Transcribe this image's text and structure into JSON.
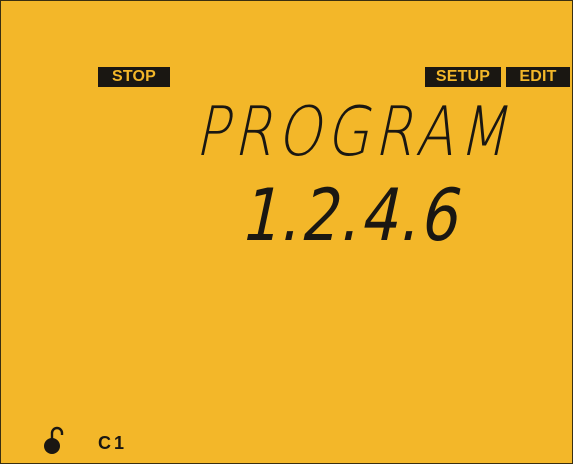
{
  "status": {
    "mode_tag": "STOP",
    "setup_tag": "SETUP",
    "edit_tag": "EDIT"
  },
  "display": {
    "line1": "PROGRAM",
    "line2": "1.2.4.6"
  },
  "footer": {
    "lock_state": "unlocked",
    "channel": "C1"
  },
  "colors": {
    "lcd_background": "#f3b729",
    "segment": "#1a1712"
  }
}
